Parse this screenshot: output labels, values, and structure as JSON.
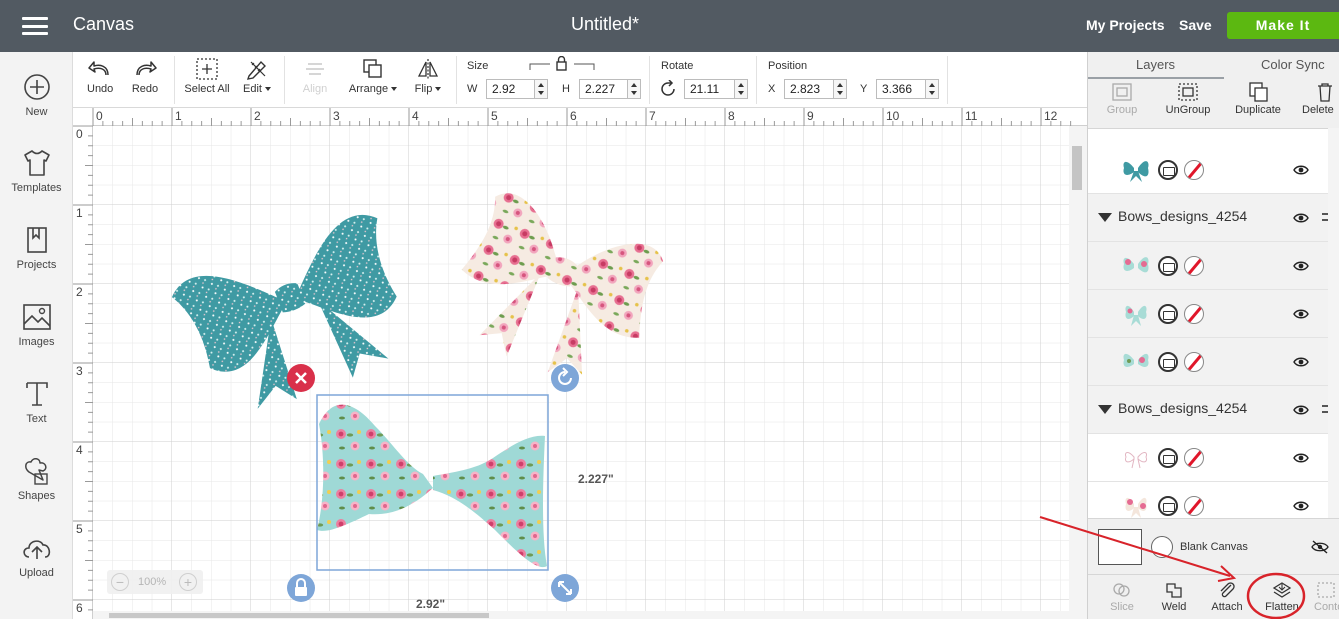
{
  "header": {
    "app_title": "Canvas",
    "doc_title": "Untitled*",
    "my_projects": "My Projects",
    "save": "Save",
    "make_it": "Make It",
    "header_bg": "#525a62",
    "make_it_color": "#5cb811"
  },
  "sidebar": {
    "items": [
      {
        "label": "New",
        "icon": "plus-circle-icon"
      },
      {
        "label": "Templates",
        "icon": "tshirt-icon"
      },
      {
        "label": "Projects",
        "icon": "bookmark-icon"
      },
      {
        "label": "Images",
        "icon": "image-icon"
      },
      {
        "label": "Text",
        "icon": "text-icon"
      },
      {
        "label": "Shapes",
        "icon": "shapes-icon"
      },
      {
        "label": "Upload",
        "icon": "cloud-upload-icon"
      }
    ]
  },
  "toolbar": {
    "undo": "Undo",
    "redo": "Redo",
    "select_all": "Select All",
    "edit": "Edit",
    "align": "Align",
    "arrange": "Arrange",
    "flip": "Flip",
    "size_label": "Size",
    "w_label": "W",
    "w_value": "2.92",
    "h_label": "H",
    "h_value": "2.227",
    "rotate_label": "Rotate",
    "rotate_value": "21.11",
    "position_label": "Position",
    "x_label": "X",
    "x_value": "2.823",
    "y_label": "Y",
    "y_value": "3.366"
  },
  "canvas": {
    "ruler_x": [
      "0",
      "1",
      "2",
      "3",
      "4",
      "5",
      "6",
      "7",
      "8",
      "9",
      "10",
      "11",
      "12"
    ],
    "ruler_y": [
      "0",
      "1",
      "2",
      "3",
      "4",
      "5",
      "6"
    ],
    "selection_height_label": "2.227\"",
    "selection_width_label": "2.92\"",
    "zoom_level": "100%",
    "teal_bow_color": "#3f9aa3",
    "mint_bow_color": "#9fd9d6",
    "accent_red": "#d9304a",
    "handle_blue": "#7ea6d8"
  },
  "layers_panel": {
    "tab_layers": "Layers",
    "tab_color_sync": "Color Sync",
    "group": "Group",
    "ungroup": "UnGroup",
    "duplicate": "Duplicate",
    "delete": "Delete",
    "group1_name": "Bows_designs_4254",
    "group2_name": "Bows_designs_4254",
    "blank_canvas": "Blank Canvas",
    "slice": "Slice",
    "weld": "Weld",
    "attach": "Attach",
    "flatten": "Flatten",
    "contour": "Contour",
    "annotation_color": "#d8232a"
  }
}
